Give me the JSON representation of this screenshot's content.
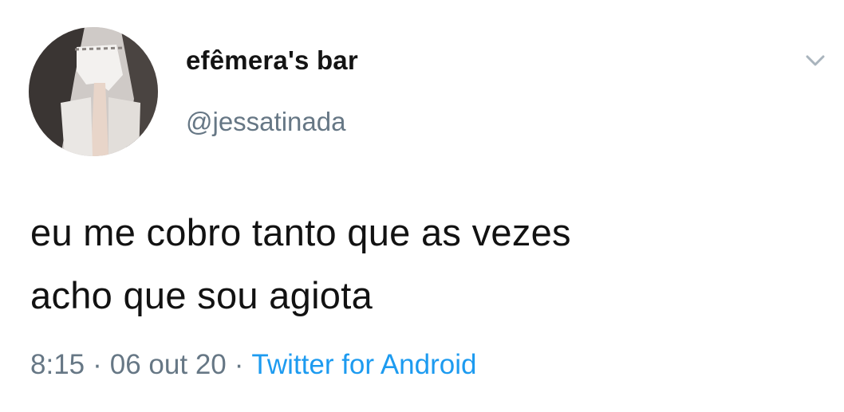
{
  "tweet": {
    "author": {
      "display_name": "efêmera's bar",
      "handle": "@jessatinada",
      "avatar_icon": "profile-photo"
    },
    "menu_icon": "chevron-down-icon",
    "text_lines": [
      "eu me cobro tanto que as vezes",
      "acho que sou agiota"
    ],
    "meta": {
      "time": "8:15",
      "separator": "·",
      "date": "06 out 20",
      "source": "Twitter for Android"
    }
  },
  "colors": {
    "text": "#121212",
    "muted": "#667785",
    "link": "#1d9bf0",
    "background": "#ffffff"
  }
}
